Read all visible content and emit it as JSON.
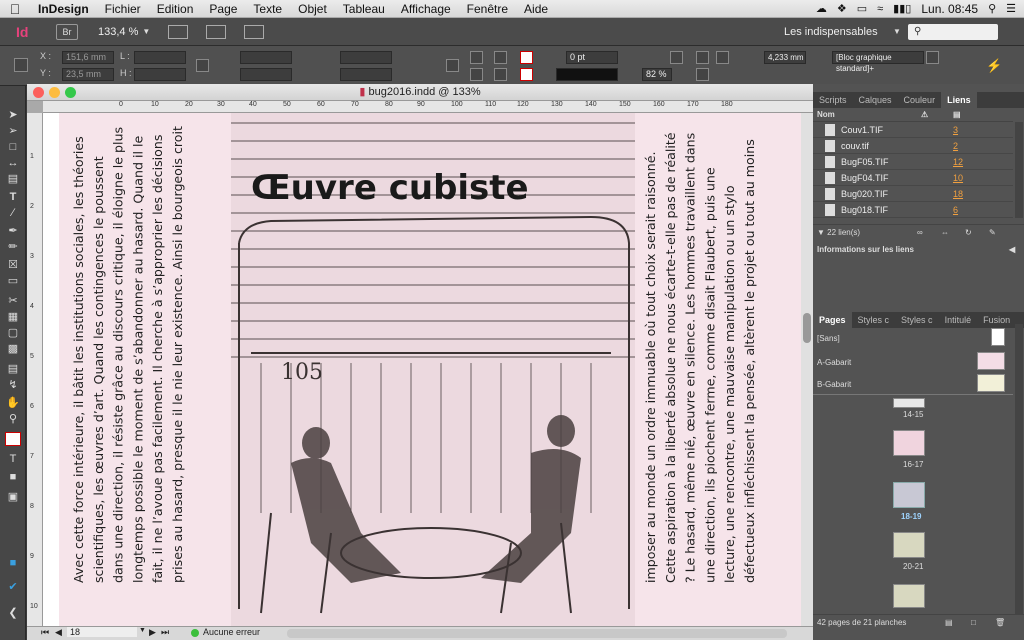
{
  "menubar": {
    "app": "InDesign",
    "items": [
      "Fichier",
      "Edition",
      "Page",
      "Texte",
      "Objet",
      "Tableau",
      "Affichage",
      "Fenêtre",
      "Aide"
    ],
    "clock": "Lun. 08:45"
  },
  "appbar": {
    "logo": "Id",
    "bridge": "Br",
    "zoom": "133,4 %",
    "workspace": "Les indispensables",
    "search_placeholder": ""
  },
  "control": {
    "x_label": "X :",
    "x_value": "151,6 mm",
    "y_label": "Y :",
    "y_value": "23,5 mm",
    "l_label": "L :",
    "h_label": "H :",
    "stroke": "0 pt",
    "opacity": "82 %",
    "size": "4,233 mm",
    "style": "[Bloc graphique standard]+"
  },
  "document": {
    "title": "bug2016.indd @ 133%",
    "hruler": [
      "0",
      "10",
      "20",
      "30",
      "40",
      "50",
      "60",
      "70",
      "80",
      "90",
      "100",
      "110",
      "120",
      "130",
      "140",
      "150",
      "160",
      "170",
      "180"
    ],
    "vruler": [
      "1",
      "2",
      "3",
      "4",
      "5",
      "6",
      "7",
      "8",
      "9",
      "10"
    ],
    "left_text": "Avec cette force intérieure, il bâtit les institutions sociales, les théories scientifiques, les œuvres d’art. Quand les contingences le poussent dans une direction, il résiste grâce au discours critique, il éloigne le plus longtemps possible le moment de s’abandonner au hasard. Quand il le fait, il ne l’avoue pas facilement. Il cherche à s’approprier les décisions prises au hasard, presque il le nie leur existence. Ainsi le bourgeois croit",
    "right_text": "imposer au monde un ordre immuable où tout choix serait raisonné. Cette aspiration à la liberté absolue ne nous écarte-t-elle pas de réalité ? Le hasard, même nié, œuvre en silence. Les hommes travaillent dans une direction, ils piochent ferme, comme disait Flaubert, puis une lecture, une rencontre, une mauvaise manipulation ou un stylo défectueux infléchissent la pensée, altèrent le projet ou tout au moins",
    "image_title": "Œuvre cubiste",
    "image_page_number": "105",
    "page_number": "18",
    "status": "Aucune erreur"
  },
  "links_panel": {
    "tabs": [
      "Scripts",
      "Calques",
      "Couleur",
      "Liens"
    ],
    "header_name": "Nom",
    "items": [
      {
        "name": "Couv1.TIF",
        "page": "3"
      },
      {
        "name": "couv.tif",
        "page": "2"
      },
      {
        "name": "BugF05.TIF",
        "page": "12"
      },
      {
        "name": "BugF04.TIF",
        "page": "10"
      },
      {
        "name": "Bug020.TIF",
        "page": "18"
      },
      {
        "name": "Bug018.TIF",
        "page": "6"
      }
    ],
    "count": "22 lien(s)",
    "info_title": "Informations sur les liens"
  },
  "pages_panel": {
    "tabs": [
      "Pages",
      "Styles c",
      "Styles c",
      "Intitulé",
      "Fusion"
    ],
    "masters": [
      "[Sans]",
      "A-Gabarit",
      "B-Gabarit"
    ],
    "spreads": [
      "14-15",
      "16-17",
      "18-19",
      "20-21"
    ],
    "footer": "42 pages de 21 planches"
  },
  "colors": {
    "page": "#f6e4ea",
    "accent": "#f0a040",
    "menu": "#e6e6e6"
  }
}
